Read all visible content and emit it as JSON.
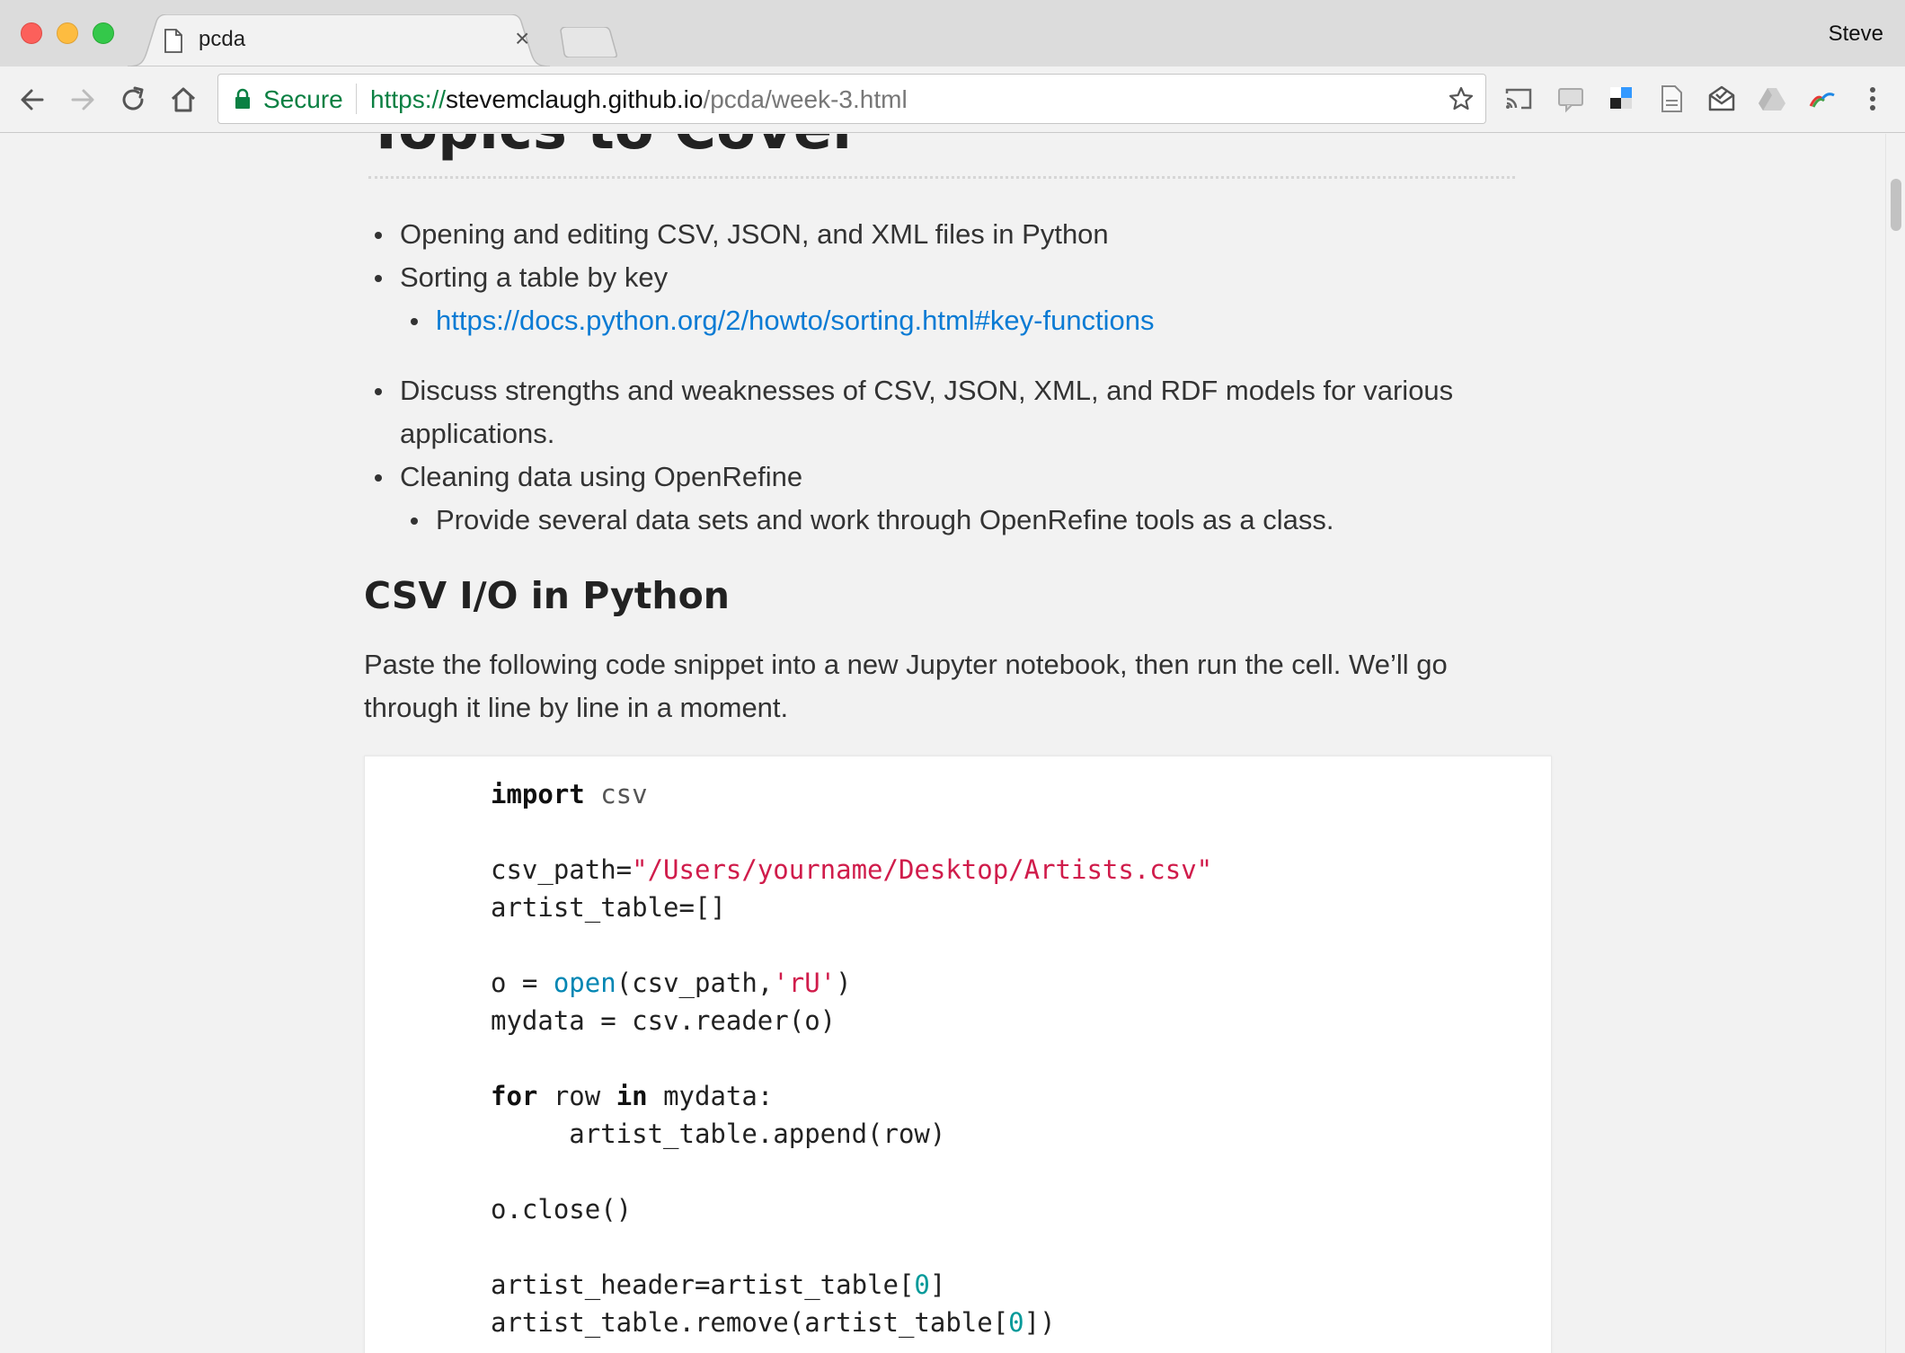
{
  "browser": {
    "tab_title": "pcda",
    "profile_name": "Steve",
    "secure_label": "Secure",
    "url_scheme": "https://",
    "url_host": "stevemclaugh.github.io",
    "url_path": "/pcda/week-3.html"
  },
  "page": {
    "heading1": "Topics to Cover",
    "topics": [
      {
        "text": "Opening and editing CSV, JSON, and XML files in Python"
      },
      {
        "text": "Sorting a table by key"
      },
      {
        "text": "https://docs.python.org/2/howto/sorting.html#key-functions"
      },
      {
        "text": "Discuss strengths and weaknesses of CSV, JSON, XML, and RDF models for various"
      },
      {
        "text": "applications."
      },
      {
        "text": "Cleaning data using OpenRefine"
      },
      {
        "text": "Provide several data sets and work through OpenRefine tools as a class."
      }
    ],
    "heading2": "CSV I/O in Python",
    "intro_line1": "Paste the following code snippet into a new Jupyter notebook, then run the cell. We’ll go",
    "intro_line2": "through it line by line in a moment.",
    "code": {
      "l1_kw": "import",
      "l1_mod": " csv",
      "l2_a": "csv_path=",
      "l2_str": "\"/Users/yourname/Desktop/Artists.csv\"",
      "l3": "artist_table=[]",
      "l4_a": "o = ",
      "l4_builtin": "open",
      "l4_b": "(csv_path,",
      "l4_str": "'rU'",
      "l4_c": ")",
      "l5": "mydata = csv.reader(o)",
      "l6_kw1": "for",
      "l6_a": " row ",
      "l6_kw2": "in",
      "l6_b": " mydata:",
      "l7": "     artist_table.append(row)",
      "l8": "o.close()",
      "l9_a": "artist_header=artist_table[",
      "l9_num": "0",
      "l9_b": "]",
      "l10_a": "artist_table.remove(artist_table[",
      "l10_num": "0",
      "l10_b": "])"
    }
  },
  "colors": {
    "link": "#0a7bd4",
    "secure": "#0b8043",
    "string": "#d01c4b",
    "builtin": "#0086b3",
    "number": "#009999"
  }
}
